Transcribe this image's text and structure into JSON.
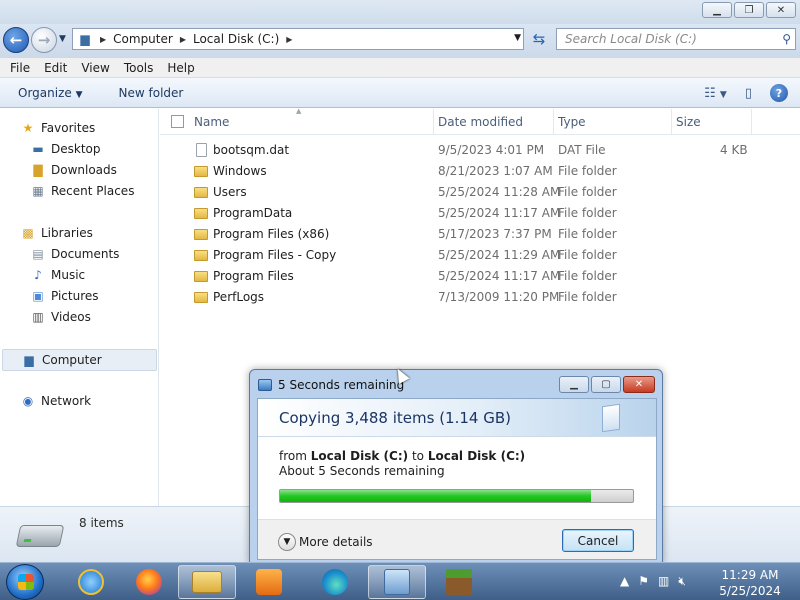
{
  "window": {
    "caption_buttons": [
      "minimize",
      "maximize",
      "close"
    ]
  },
  "address": {
    "crumbs": [
      "Computer",
      "Local Disk (C:)"
    ],
    "search_placeholder": "Search Local Disk (C:)"
  },
  "menu": [
    "File",
    "Edit",
    "View",
    "Tools",
    "Help"
  ],
  "toolbar": {
    "organize": "Organize",
    "new_folder": "New folder"
  },
  "nav": {
    "favorites": "Favorites",
    "desktop": "Desktop",
    "downloads": "Downloads",
    "recent": "Recent Places",
    "libraries": "Libraries",
    "documents": "Documents",
    "music": "Music",
    "pictures": "Pictures",
    "videos": "Videos",
    "computer": "Computer",
    "network": "Network"
  },
  "columns": {
    "name": "Name",
    "date": "Date modified",
    "type": "Type",
    "size": "Size"
  },
  "files": [
    {
      "name": "bootsqm.dat",
      "date": "9/5/2023 4:01 PM",
      "type": "DAT File",
      "size": "4 KB",
      "kind": "file"
    },
    {
      "name": "Windows",
      "date": "8/21/2023 1:07 AM",
      "type": "File folder",
      "size": "",
      "kind": "folder"
    },
    {
      "name": "Users",
      "date": "5/25/2024 11:28 AM",
      "type": "File folder",
      "size": "",
      "kind": "folder"
    },
    {
      "name": "ProgramData",
      "date": "5/25/2024 11:17 AM",
      "type": "File folder",
      "size": "",
      "kind": "folder"
    },
    {
      "name": "Program Files (x86)",
      "date": "5/17/2023 7:37 PM",
      "type": "File folder",
      "size": "",
      "kind": "folder"
    },
    {
      "name": "Program Files - Copy",
      "date": "5/25/2024 11:29 AM",
      "type": "File folder",
      "size": "",
      "kind": "folder"
    },
    {
      "name": "Program Files",
      "date": "5/25/2024 11:17 AM",
      "type": "File folder",
      "size": "",
      "kind": "folder"
    },
    {
      "name": "PerfLogs",
      "date": "7/13/2009 11:20 PM",
      "type": "File folder",
      "size": "",
      "kind": "folder"
    }
  ],
  "details": {
    "count": "8 items"
  },
  "dialog": {
    "title": "5 Seconds remaining",
    "heading": "Copying 3,488 items (1.14 GB)",
    "from_label": "from",
    "source": "Local Disk (C:)",
    "to_label": "to",
    "dest": "Local Disk (C:)",
    "remaining": "About 5 Seconds remaining",
    "progress": 0.88,
    "more_details": "More details",
    "cancel": "Cancel"
  },
  "taskbar": {
    "time": "11:29 AM",
    "date": "5/25/2024"
  }
}
